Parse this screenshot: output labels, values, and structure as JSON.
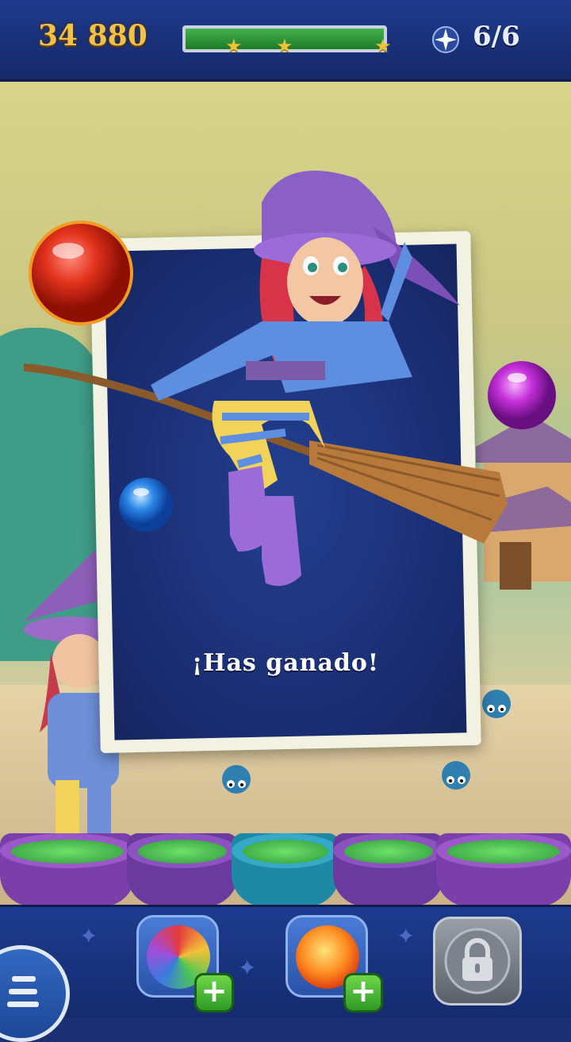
{
  "hud": {
    "score": "34 880",
    "moves": "6/6",
    "progress": 1.0,
    "stars_earned": 3,
    "star_glyph": "★"
  },
  "popup": {
    "message": "¡Has ganado!"
  },
  "boosters": [
    {
      "name": "rainbow-bubble",
      "plus": "+"
    },
    {
      "name": "fire-bubble",
      "plus": "+"
    },
    {
      "name": "locked-slot"
    }
  ],
  "colors": {
    "score_gold": "#f2c14a",
    "progress_green": "#2fa33b",
    "card_blue": "#1d327a",
    "cauldron_brew": "#4cc653"
  }
}
